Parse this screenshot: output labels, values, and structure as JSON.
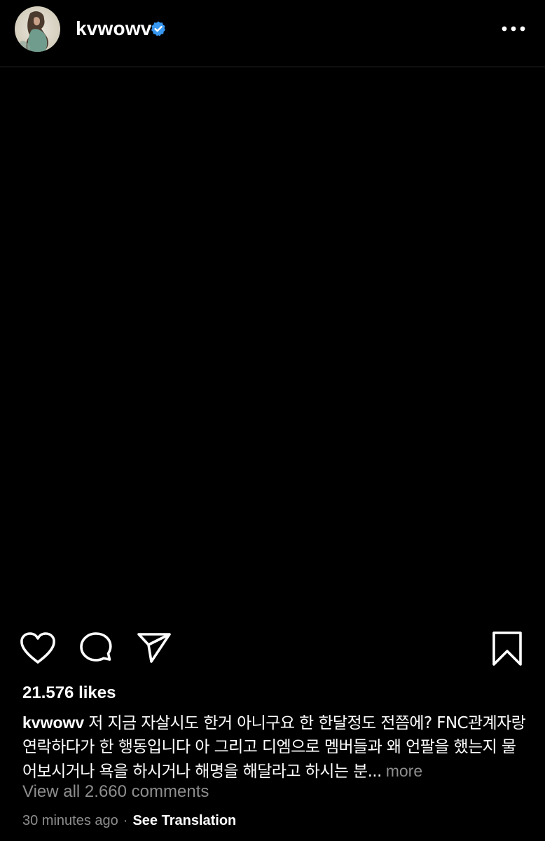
{
  "post": {
    "username": "kvwowv",
    "verified": true,
    "verified_color": "#3897f0",
    "likes_text": "21.576 likes",
    "caption_text": "저 지금 자살시도 한거 아니구요 한 한달정도 전쯤에? FNC관계자랑 연락하다가 한 행동입니다 아 그리고 디엠으로 멤버들과 왜 언팔을 했는지 물어보시거나 욕을 하시거나 해명을 해달라고 하시는 분...",
    "caption_more": "more",
    "view_all_comments": "View all 2.660 comments",
    "timestamp": "30 minutes ago",
    "separator": "·",
    "see_translation": "See Translation"
  },
  "icons": {
    "avatar": "avatar",
    "verified": "verified-badge-icon",
    "more": "more-options-icon",
    "like": "heart-icon",
    "comment": "comment-icon",
    "share": "send-icon",
    "save": "bookmark-icon"
  }
}
